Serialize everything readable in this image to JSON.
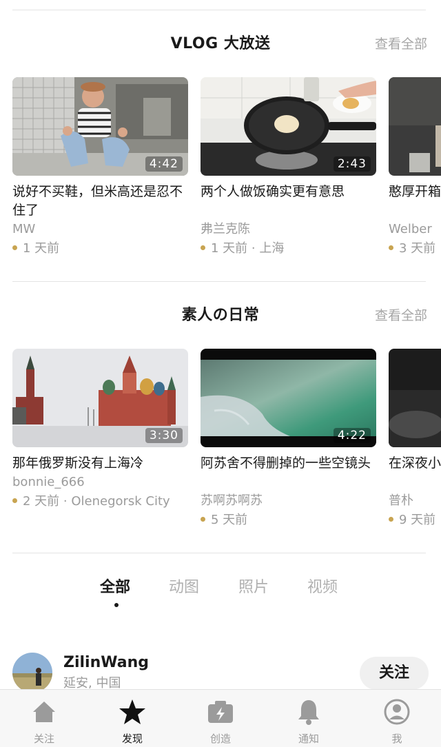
{
  "sections": [
    {
      "title": "VLOG 大放送",
      "see_all": "查看全部",
      "cards": [
        {
          "duration": "4:42",
          "title": "说好不买鞋，但米高还是忍不住了",
          "author": "MW",
          "meta": "1 天前"
        },
        {
          "duration": "2:43",
          "title": "两个人做饭确实更有意思",
          "author": "弗兰克陈",
          "meta": "1 天前 · 上海"
        },
        {
          "duration": "",
          "title": "憨厚开箱气垫",
          "author": "Welber",
          "meta": "3 天前"
        }
      ]
    },
    {
      "title": "素人の日常",
      "see_all": "查看全部",
      "cards": [
        {
          "duration": "3:30",
          "title": "那年俄罗斯没有上海冷",
          "author": "bonnie_666",
          "meta": "2 天前 · Olenegorsk City"
        },
        {
          "duration": "4:22",
          "title": "阿苏舍不得删掉的一些空镜头",
          "author": "苏啊苏啊苏",
          "meta": "5 天前"
        },
        {
          "duration": "",
          "title": "在深夜小晚上",
          "author": "普朴",
          "meta": "9 天前"
        }
      ]
    }
  ],
  "filter_tabs": [
    "全部",
    "动图",
    "照片",
    "视频"
  ],
  "active_filter": "全部",
  "user": {
    "name": "ZilinWang",
    "location": "延安, 中国",
    "follow_label": "关注"
  },
  "tabbar": [
    {
      "label": "关注",
      "icon": "home-icon"
    },
    {
      "label": "发现",
      "icon": "star-icon"
    },
    {
      "label": "创造",
      "icon": "camera-bolt-icon"
    },
    {
      "label": "通知",
      "icon": "bell-icon"
    },
    {
      "label": "我",
      "icon": "profile-icon"
    }
  ],
  "active_tab": "发现",
  "colors": {
    "accent_dot": "#c8a451",
    "muted_text": "#9b9b9b",
    "tabbar_bg": "#f7f7f7"
  }
}
